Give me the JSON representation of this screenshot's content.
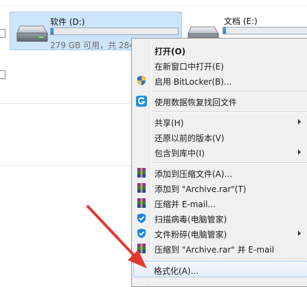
{
  "drives": [
    {
      "name": "软件 (D:)",
      "space_text": "279 GB 可用，共 284",
      "used_fraction": 0.02,
      "selected": true
    },
    {
      "name": "文档 (E:)",
      "space_text": "",
      "used_fraction": 0.03,
      "selected": false
    }
  ],
  "menu": {
    "items": [
      {
        "label": "打开(O)",
        "bold": true,
        "icon": "",
        "submenu": false
      },
      {
        "label": "在新窗口中打开(E)",
        "bold": false,
        "icon": "",
        "submenu": false
      },
      {
        "label": "启用 BitLocker(B)...",
        "bold": false,
        "icon": "shield-uac-icon",
        "submenu": false
      },
      {
        "label": "使用数据恢复找回文件",
        "bold": false,
        "icon": "recovery-g-icon",
        "submenu": false
      },
      {
        "label": "共享(H)",
        "bold": false,
        "icon": "",
        "submenu": true
      },
      {
        "label": "还原以前的版本(V)",
        "bold": false,
        "icon": "",
        "submenu": false
      },
      {
        "label": "包含到库中(I)",
        "bold": false,
        "icon": "",
        "submenu": true
      },
      {
        "label": "添加到压缩文件(A)...",
        "bold": false,
        "icon": "winrar-icon",
        "submenu": false
      },
      {
        "label": "添加到 \"Archive.rar\"(T)",
        "bold": false,
        "icon": "winrar-icon",
        "submenu": false
      },
      {
        "label": "压缩并 E-mail...",
        "bold": false,
        "icon": "winrar-icon",
        "submenu": false
      },
      {
        "label": "扫描病毒(电脑管家)",
        "bold": false,
        "icon": "pcmgr-shield-icon",
        "submenu": false
      },
      {
        "label": "文件粉碎(电脑管家)",
        "bold": false,
        "icon": "pcmgr-shield-icon",
        "submenu": true
      },
      {
        "label": "压缩到 \"Archive.rar\" 并 E-mail",
        "bold": false,
        "icon": "winrar-icon",
        "submenu": false
      },
      {
        "label": "格式化(A)...",
        "bold": false,
        "icon": "",
        "submenu": false
      }
    ]
  },
  "colors": {
    "accent_arrow": "#e03a2f",
    "selection": "#cde5fb"
  }
}
